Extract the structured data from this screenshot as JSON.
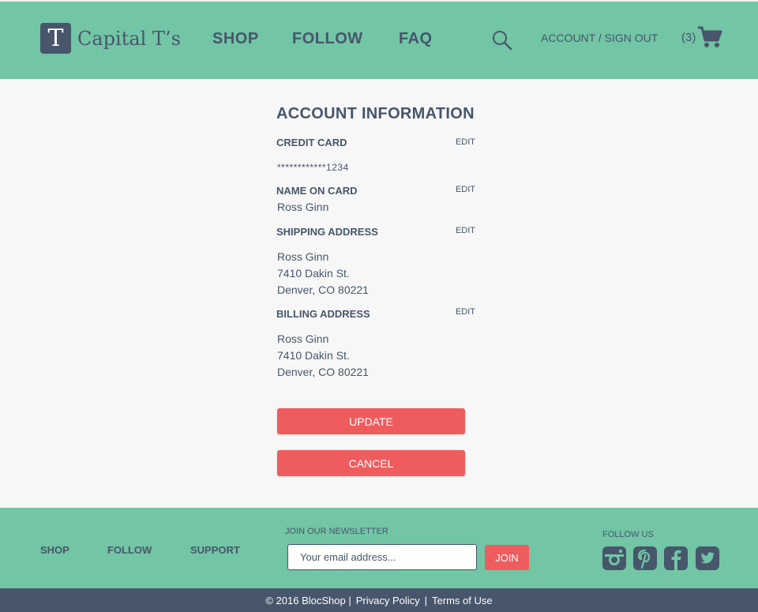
{
  "header": {
    "logo_letter": "T",
    "brand": "Capital T’s",
    "nav": [
      "SHOP",
      "FOLLOW",
      "FAQ"
    ],
    "account_link": "ACCOUNT / SIGN OUT",
    "cart_count": "(3)"
  },
  "account": {
    "title": "ACCOUNT INFORMATION",
    "edit_label": "EDIT",
    "credit_card": {
      "label": "CREDIT CARD",
      "value": "************1234"
    },
    "name_on_card": {
      "label": "NAME ON CARD",
      "value": "Ross Ginn"
    },
    "shipping": {
      "label": "SHIPPING ADDRESS",
      "lines": [
        "Ross Ginn",
        "7410 Dakin St.",
        "Denver, CO 80221"
      ]
    },
    "billing": {
      "label": "BILLING ADDRESS",
      "lines": [
        "Ross Ginn",
        "7410 Dakin St.",
        "Denver, CO 80221"
      ]
    },
    "update_label": "UPDATE",
    "cancel_label": "CANCEL"
  },
  "footer": {
    "nav": [
      "SHOP",
      "FOLLOW",
      "SUPPORT"
    ],
    "newsletter_label": "JOIN OUR NEWSLETTER",
    "email_placeholder": "Your email address...",
    "join_label": "JOIN",
    "follow_label": "FOLLOW US",
    "social_icons": [
      "instagram-icon",
      "pinterest-icon",
      "facebook-icon",
      "twitter-icon"
    ]
  },
  "bottom": {
    "copyright": "© 2016 BlocShop |",
    "privacy": "Privacy Policy",
    "separator": "|",
    "terms": "Terms of Use"
  },
  "colors": {
    "accent": "#72c5a5",
    "navy": "#47566b",
    "button": "#ef5c5e",
    "background": "#f7f7f7"
  }
}
